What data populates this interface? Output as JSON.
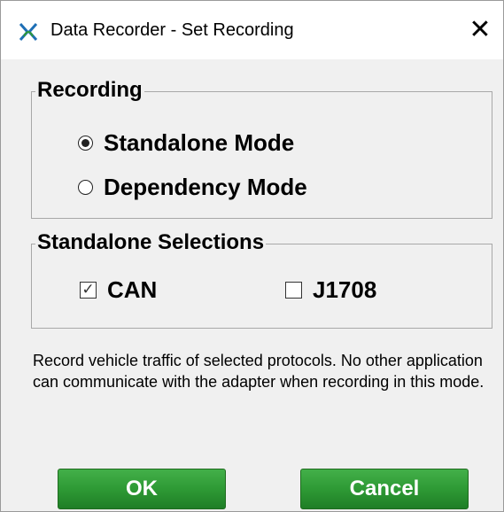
{
  "window": {
    "title": "Data Recorder - Set Recording",
    "close_glyph": "✕",
    "app_icon": "data-recorder-logo-icon",
    "accent_color": "#1e6fb5"
  },
  "recording_group": {
    "label": "Recording",
    "options": [
      {
        "label": "Standalone Mode",
        "selected": true
      },
      {
        "label": "Dependency Mode",
        "selected": false
      }
    ]
  },
  "standalone_group": {
    "label": "Standalone Selections",
    "options": [
      {
        "label": "CAN",
        "checked": true,
        "check_glyph": "✓"
      },
      {
        "label": "J1708",
        "checked": false,
        "check_glyph": ""
      }
    ]
  },
  "description": "Record vehicle traffic of selected protocols. No other application can communicate with the adapter when recording in this mode.",
  "buttons": {
    "ok_label": "OK",
    "cancel_label": "Cancel",
    "color": "#2e9a35"
  }
}
